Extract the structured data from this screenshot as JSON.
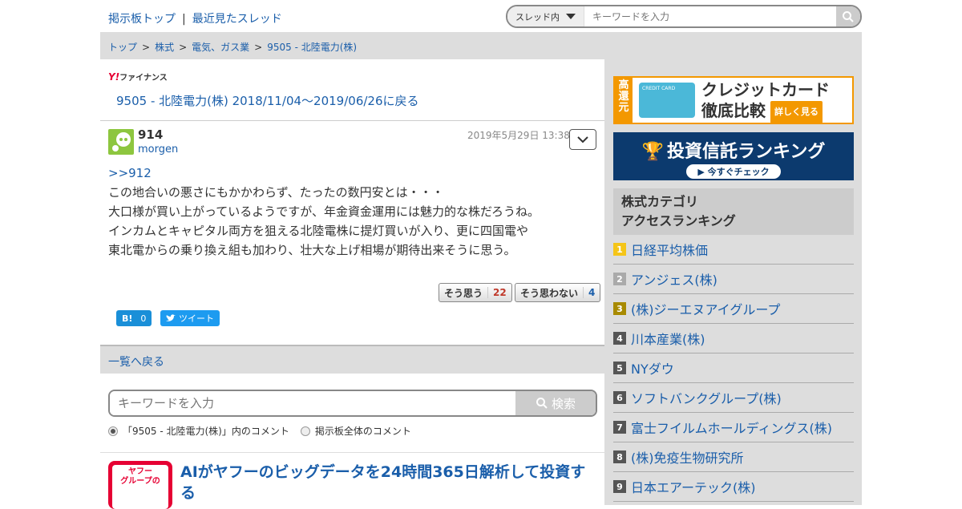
{
  "header": {
    "nav_top": "掲示板トップ",
    "nav_sep": "|",
    "nav_recent": "最近見たスレッド",
    "search_scope": "スレッド内",
    "search_placeholder": "キーワードを入力"
  },
  "breadcrumb": [
    "トップ",
    "株式",
    "電気、ガス業",
    "9505 - 北陸電力(株)"
  ],
  "main": {
    "logo_y": "Y!",
    "logo_text": "ファイナンス",
    "back_link": "9505 - 北陸電力(株) 2018/11/04〜2019/06/26に戻る",
    "post": {
      "number": "914",
      "user": "morgen",
      "date": "2019年5月29日 13:38",
      "reply_to": ">>912",
      "lines": [
        "この地合いの悪さにもかかわらず、たったの数円安とは・・・",
        "大口様が買い上がっているようですが、年金資金運用には魅力的な株だろうね。",
        "インカムとキャピタル両方を狙える北陸電株に提灯買いが入り、更に四国電や",
        "東北電からの乗り換え組も加わり、壮大な上げ相場が期待出来そうに思う。"
      ],
      "agree_label": "そう思う",
      "agree_count": "22",
      "disagree_label": "そう思わない",
      "disagree_count": "4",
      "hatena_label": "B!",
      "hatena_count": "0",
      "tweet_label": "ツイート"
    },
    "back_list": "一覧へ戻る",
    "search": {
      "placeholder": "キーワードを入力",
      "button": "検索",
      "option1": "「9505 - 北陸電力(株)」内のコメント",
      "option2": "掲示板全体のコメント"
    },
    "ad": {
      "logo_line1": "ヤフー",
      "logo_line2": "グループの",
      "title": "AIがヤフーのビッグデータを24時間365日解析して投資する"
    }
  },
  "sidebar": {
    "banner1": {
      "tag": "高還元",
      "card": "CREDIT CARD",
      "line1": "クレジットカード",
      "line2": "徹底比較",
      "cta": "詳しく見る"
    },
    "banner2": {
      "title": "投資信託ランキング",
      "cta": "今すぐチェック"
    },
    "ranking_title_1": "株式カテゴリ",
    "ranking_title_2": "アクセスランキング",
    "ranking": [
      {
        "rank": "1",
        "name": "日経平均株価",
        "color": "#f5c518"
      },
      {
        "rank": "2",
        "name": "アンジェス(株)",
        "color": "#aaaaaa"
      },
      {
        "rank": "3",
        "name": "(株)ジーエヌアイグループ",
        "color": "#a88a00"
      },
      {
        "rank": "4",
        "name": "川本産業(株)",
        "color": "#555555"
      },
      {
        "rank": "5",
        "name": "NYダウ",
        "color": "#555555"
      },
      {
        "rank": "6",
        "name": "ソフトバンクグループ(株)",
        "color": "#555555"
      },
      {
        "rank": "7",
        "name": "富士フイルムホールディングス(株)",
        "color": "#555555"
      },
      {
        "rank": "8",
        "name": "(株)免疫生物研究所",
        "color": "#555555"
      },
      {
        "rank": "9",
        "name": "日本エアーテック(株)",
        "color": "#555555"
      }
    ]
  }
}
